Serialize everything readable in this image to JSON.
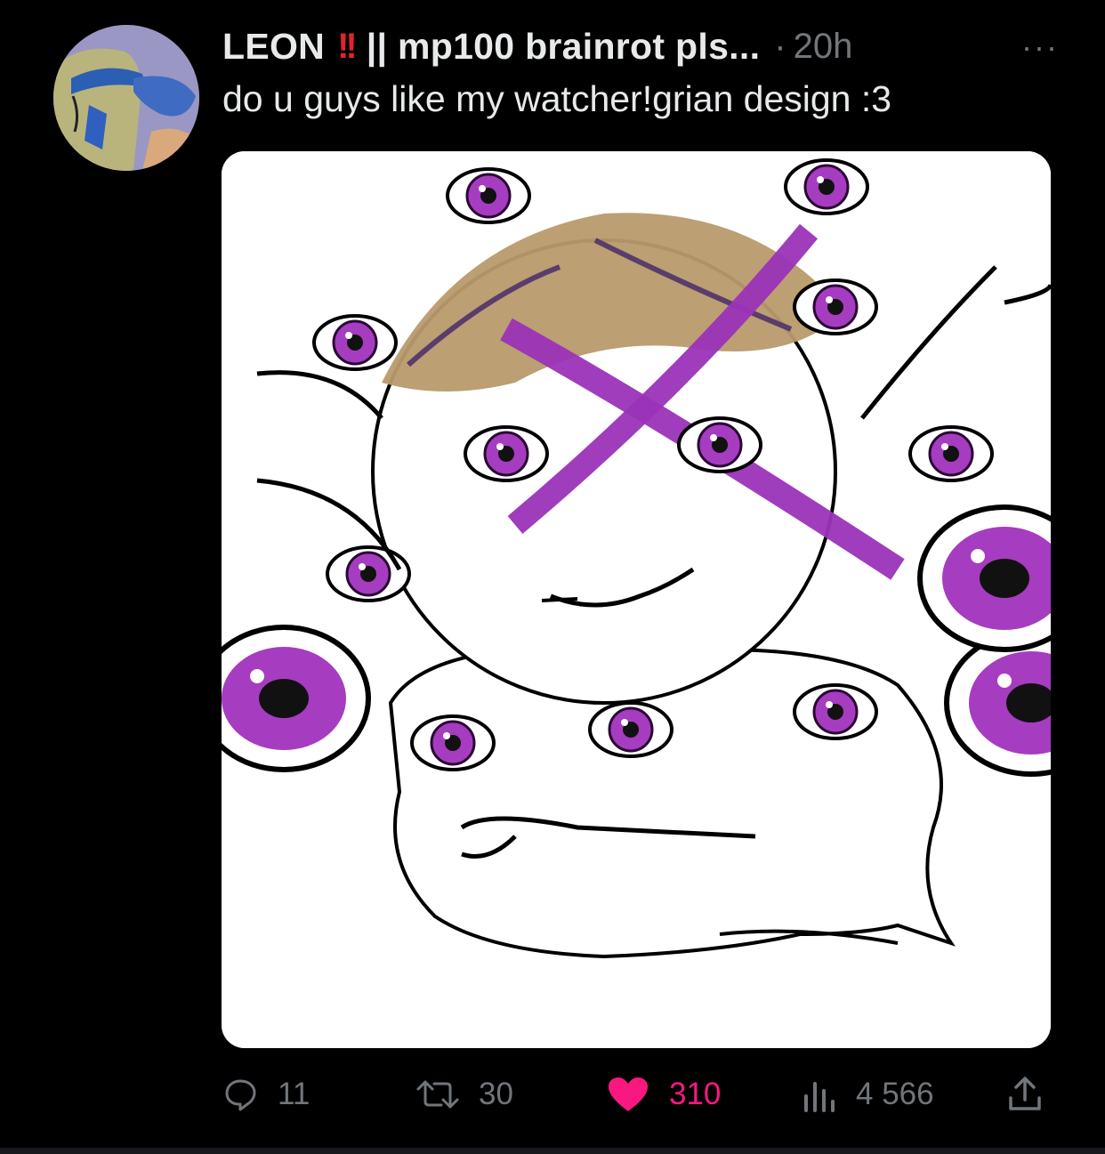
{
  "tweet": {
    "display_name": "LEON",
    "emoji": "!!",
    "name_suffix": "|| mp100 brainrot pls...",
    "separator": "·",
    "time": "20h",
    "more_label": "···",
    "text": "do u guys like my watcher!grian design :3"
  },
  "actions": {
    "replies": "11",
    "retweets": "30",
    "likes": "310",
    "views": "4 566"
  },
  "icons": [
    "avatar",
    "reply-icon",
    "retweet-icon",
    "heart-icon",
    "views-icon",
    "share-icon",
    "more-icon"
  ],
  "colors": {
    "background": "#000000",
    "text": "#e7e9ea",
    "muted": "#71767b",
    "like": "#f91880",
    "emoji": "#e0242b",
    "eye_purple": "#a63cc0",
    "hair": "#b89a6a"
  }
}
